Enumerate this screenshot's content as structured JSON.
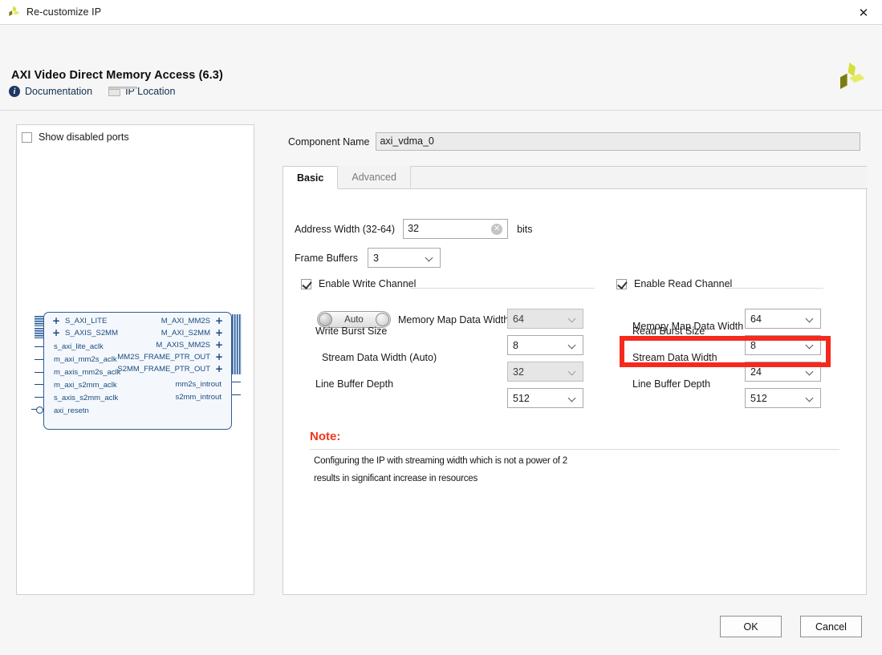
{
  "window": {
    "title": "Re-customize IP",
    "icon": "xilinx-logo-icon",
    "close_label": "✕"
  },
  "header": {
    "ip_title": "AXI Video Direct Memory Access (6.3)",
    "logo": "xilinx-pinwheel-logo",
    "links": [
      {
        "label": "Documentation",
        "icon": "info-icon"
      },
      {
        "label": "IP Location",
        "icon": "folder-icon"
      }
    ]
  },
  "left_panel": {
    "show_disabled_ports": {
      "label": "Show disabled ports",
      "checked": false
    },
    "diagram": {
      "left_ports": [
        {
          "name": "S_AXI_LITE",
          "kind": "bus"
        },
        {
          "name": "S_AXIS_S2MM",
          "kind": "bus"
        },
        {
          "name": "s_axi_lite_aclk",
          "kind": "wire"
        },
        {
          "name": "m_axi_mm2s_aclk",
          "kind": "wire"
        },
        {
          "name": "m_axis_mm2s_aclk",
          "kind": "wire"
        },
        {
          "name": "m_axi_s2mm_aclk",
          "kind": "wire"
        },
        {
          "name": "s_axis_s2mm_aclk",
          "kind": "wire"
        },
        {
          "name": "axi_resetn",
          "kind": "reset"
        }
      ],
      "right_ports": [
        {
          "name": "M_AXI_MM2S",
          "kind": "bus"
        },
        {
          "name": "M_AXI_S2MM",
          "kind": "bus"
        },
        {
          "name": "M_AXIS_MM2S",
          "kind": "bus"
        },
        {
          "name": "MM2S_FRAME_PTR_OUT",
          "kind": "bus"
        },
        {
          "name": "S2MM_FRAME_PTR_OUT",
          "kind": "bus"
        },
        {
          "name": "mm2s_introut",
          "kind": "wire"
        },
        {
          "name": "s2mm_introut",
          "kind": "wire"
        }
      ]
    }
  },
  "component_name": {
    "label": "Component Name",
    "value": "axi_vdma_0"
  },
  "tabs": [
    {
      "label": "Basic",
      "active": true
    },
    {
      "label": "Advanced",
      "active": false
    }
  ],
  "basic": {
    "address_width": {
      "label": "Address Width (32-64)",
      "value": "32",
      "unit": "bits",
      "clear_icon": "✕"
    },
    "frame_buffers": {
      "label": "Frame Buffers",
      "value": "3"
    },
    "write_channel": {
      "enable_label": "Enable Write Channel",
      "enabled": true,
      "auto_toggle": {
        "label": "Auto",
        "state": "on"
      },
      "fields": [
        {
          "label": "Memory Map Data Width",
          "value": "64",
          "disabled": true
        },
        {
          "label": "Write Burst Size",
          "value": "8",
          "disabled": false
        },
        {
          "label": "Stream Data Width (Auto)",
          "value": "32",
          "disabled": true
        },
        {
          "label": "Line Buffer Depth",
          "value": "512",
          "disabled": false
        }
      ]
    },
    "read_channel": {
      "enable_label": "Enable Read Channel",
      "enabled": true,
      "fields": [
        {
          "label": "Memory Map Data Width",
          "value": "64",
          "disabled": false
        },
        {
          "label": "Read Burst Size",
          "value": "8",
          "disabled": false
        },
        {
          "label": "Stream Data Width",
          "value": "24",
          "disabled": false,
          "highlighted": true
        },
        {
          "label": "Line Buffer Depth",
          "value": "512",
          "disabled": false
        }
      ]
    },
    "note": {
      "title": "Note:",
      "lines": [
        "Configuring the IP with streaming width which is not a power of 2",
        "results in significant increase in resources"
      ]
    }
  },
  "footer": {
    "ok_label": "OK",
    "cancel_label": "Cancel"
  },
  "colors": {
    "highlight_red": "#f5291c",
    "note_red": "#f0361c",
    "diagram_blue": "#1b4a7e",
    "link_blue": "#11304f"
  }
}
